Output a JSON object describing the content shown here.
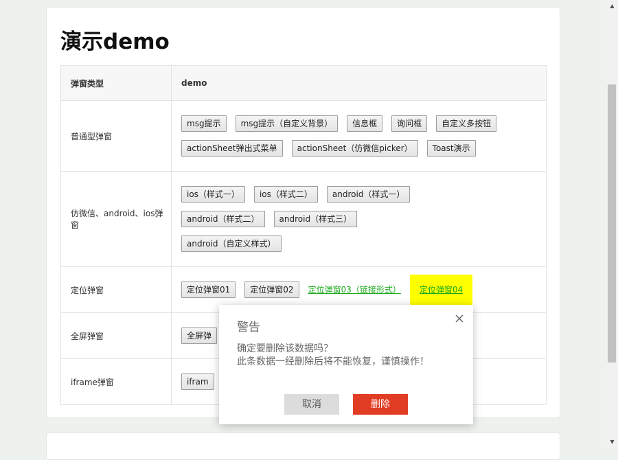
{
  "page": {
    "title": "演示demo"
  },
  "table": {
    "headers": [
      "弹窗类型",
      "demo"
    ],
    "rows": [
      {
        "type": "普通型弹窗",
        "buttons": [
          "msg提示",
          "msg提示（自定义背景）",
          "信息框",
          "询问框",
          "自定义多按钮",
          "actionSheet弹出式菜单",
          "actionSheet（仿微信picker）",
          "Toast演示"
        ]
      },
      {
        "type": "仿微信、android、ios弹窗",
        "buttons": [
          "ios（样式一）",
          "ios（样式二）",
          "android（样式一）",
          "android（样式二）",
          "android（样式三）",
          "android（自定义样式）"
        ]
      },
      {
        "type": "定位弹窗",
        "buttons": [
          "定位弹窗01",
          "定位弹窗02"
        ],
        "links": [
          "定位弹窗03（链接形式）",
          "定位弹窗04"
        ]
      },
      {
        "type": "全屏弹窗",
        "buttons": [
          "全屏弹"
        ]
      },
      {
        "type": "iframe弹窗",
        "buttons": [
          "ifram"
        ]
      }
    ]
  },
  "dialog": {
    "title": "警告",
    "line1": "确定要删除该数据吗？",
    "line2": "此条数据一经删除后将不能恢复，谨慎操作！",
    "cancel_label": "取消",
    "delete_label": "删除",
    "icons": {
      "close": "close-icon"
    },
    "colors": {
      "delete": "#e13d24",
      "cancel": "#dcdcdc",
      "highlight": "#ffff00",
      "link": "#1aaa1a"
    }
  },
  "scrollbar": {
    "up": "▲",
    "down": "▼"
  }
}
